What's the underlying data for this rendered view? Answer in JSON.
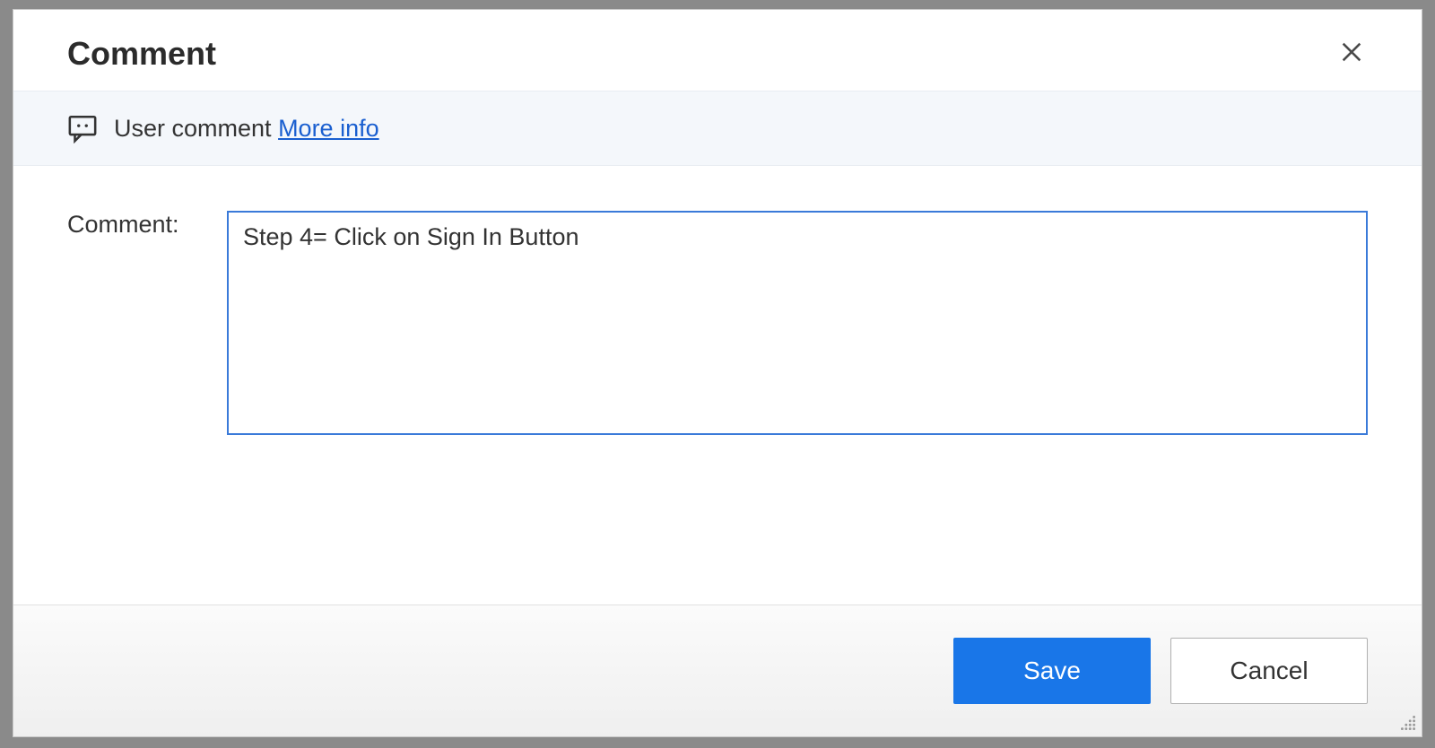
{
  "dialog": {
    "title": "Comment"
  },
  "infoBar": {
    "text": "User comment",
    "moreInfo": "More info"
  },
  "form": {
    "label": "Comment:",
    "value": "Step 4= Click on Sign In Button"
  },
  "footer": {
    "save": "Save",
    "cancel": "Cancel"
  }
}
